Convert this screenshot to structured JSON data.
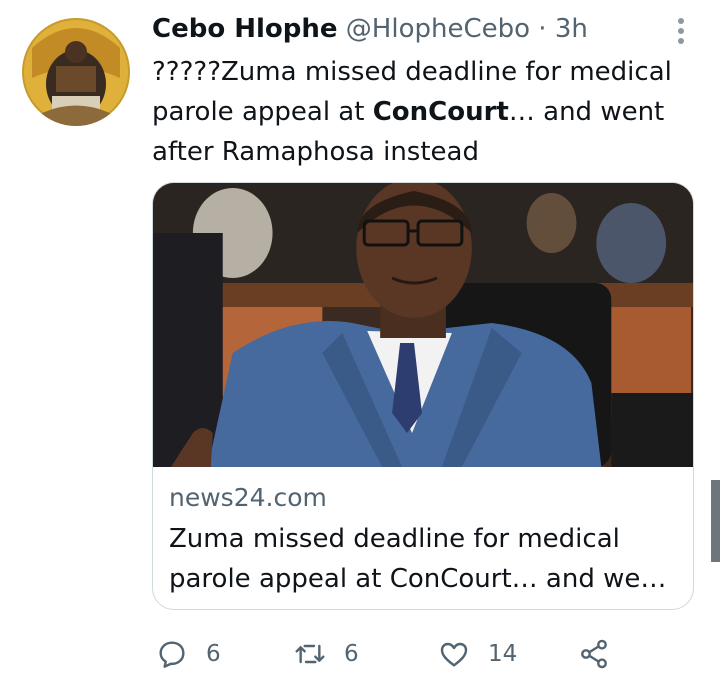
{
  "tweet": {
    "author_name": "Cebo Hlophe",
    "handle": "@HlopheCebo",
    "separator": "·",
    "time": "3h",
    "text_before_bold": "?????Zuma missed deadline for medical parole appeal at ",
    "text_bold": "ConCourt",
    "text_after_bold": "… and went after Ramaphosa instead"
  },
  "link_card": {
    "domain": "news24.com",
    "title": "Zuma missed deadline for medical parole appeal at ConCourt… and we…"
  },
  "actions": {
    "reply_count": "6",
    "retweet_count": "6",
    "like_count": "14"
  },
  "icons": [
    "more-vertical-icon",
    "reply-icon",
    "retweet-icon",
    "like-icon",
    "share-icon"
  ],
  "colors": {
    "text": "#0f1419",
    "secondary": "#536471",
    "border": "#cfd9de"
  }
}
